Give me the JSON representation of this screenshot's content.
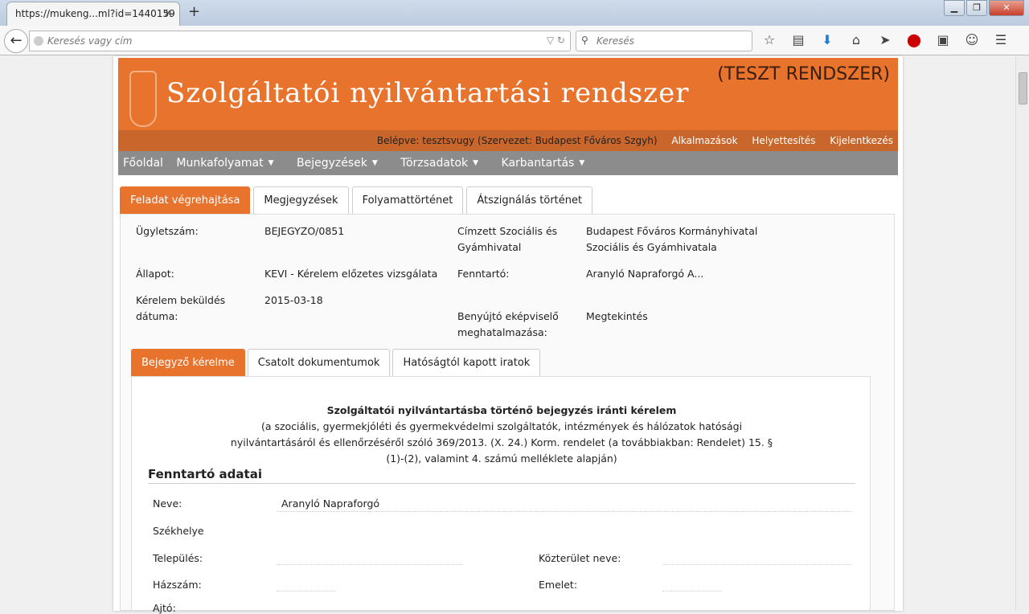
{
  "browser": {
    "tab_title": "https://mukeng...ml?id=1440159",
    "url_placeholder": "Keresés vagy cím",
    "search_placeholder": "Keresés"
  },
  "banner": {
    "title": "Szolgáltatói nyilvántartási rendszer",
    "test_label": "(TESZT RENDSZER)"
  },
  "userbar": {
    "logged_in": "Belépve: tesztsvugy (Szervezet: Budapest Főváros Szgyh)",
    "links": [
      "Alkalmazások",
      "Helyettesítés",
      "Kijelentkezés"
    ]
  },
  "menu": [
    "Főoldal",
    "Munkafolyamat",
    "Bejegyzések",
    "Törzsadatok",
    "Karbantartás"
  ],
  "tabs": [
    "Feladat végrehajtása",
    "Megjegyzések",
    "Folyamattörténet",
    "Átszignálás történet"
  ],
  "info": {
    "ugyletszam_label": "Ügyletszám:",
    "ugyletszam": "BEJEGYZO/0851",
    "allapot_label": "Állapot:",
    "allapot": "KEVI - Kérelem előzetes vizsgálata",
    "bekuldes_label1": "Kérelem beküldés",
    "bekuldes_label2": "dátuma:",
    "bekuldes": "2015-03-18",
    "cimzett_label1": "Címzett Szociális és",
    "cimzett_label2": "Gyámhivatal",
    "cimzett1": "Budapest Főváros Kormányhivatal",
    "cimzett2": "Szociális és Gyámhivatala",
    "fenntarto_label": "Fenntartó:",
    "fenntarto": "Aranyló Napraforgó A...",
    "benyujto_label1": "Benyújtó eképviselő",
    "benyujto_label2": "meghatalmazása:",
    "benyujto": "Megtekintés"
  },
  "subtabs": [
    "Bejegyző kérelme",
    "Csatolt dokumentumok",
    "Hatóságtól kapott iratok"
  ],
  "doc": {
    "title": "Szolgáltatói nyilvántartásba történő bejegyzés iránti kérelem",
    "sub1": "(a szociális, gyermekjóléti és gyermekvédelmi szolgáltatók, intézmények és hálózatok hatósági",
    "sub2": "nyilvántartásáról és ellenőrzéséről szóló 369/2013. (X. 24.) Korm. rendelet (a továbbiakban: Rendelet) 15. §",
    "sub3": "(1)-(2), valamint 4. számú melléklete alapján)",
    "section": "Fenntartó adatai",
    "neve_label": "Neve:",
    "neve": "Aranyló Napraforgó",
    "szekhely_label": "Székhelye",
    "telepules_label": "Település:",
    "kozterulet_label": "Közterület neve:",
    "hazszam_label": "Házszám:",
    "emelet_label": "Emelet:",
    "ajto_label": "Ajtó:"
  }
}
